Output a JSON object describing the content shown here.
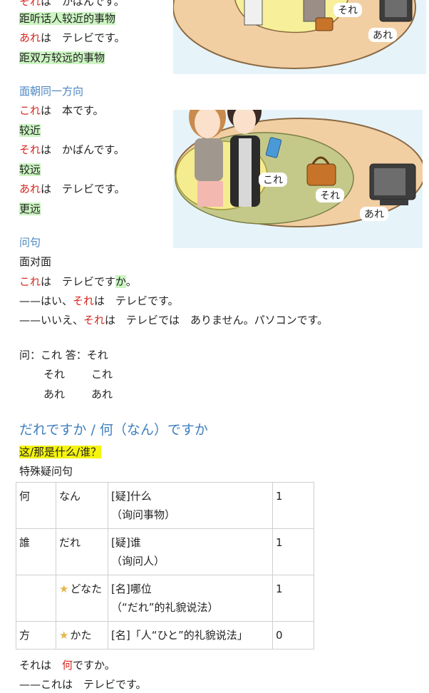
{
  "top": {
    "line1_word": "それ",
    "line1_rest": "は　かばんです。",
    "line2": "距听话人较近的事物",
    "line3_word": "あれ",
    "line3_rest": "は　テレビです。",
    "line4": "距双方较远的事物"
  },
  "section_same": {
    "heading": "面朝同一方向",
    "l1_word": "これ",
    "l1_rest": "は　本です。",
    "l2": "较近",
    "l3_word": "それ",
    "l3_rest": "は　かばんです。",
    "l4": "较远",
    "l5_word": "あれ",
    "l5_rest": "は　テレビです。",
    "l6": "更远"
  },
  "illustration_top": {
    "label_sore": "それ",
    "label_are": "あれ"
  },
  "illustration_mid": {
    "label_kore": "これ",
    "label_sore": "それ",
    "label_are": "あれ"
  },
  "section_question": {
    "heading": "问句",
    "face": "面对面",
    "q_word": "これ",
    "q_rest1": "は　テレビです",
    "q_ka": "か",
    "q_end": "。",
    "a1_dash": "——はい、",
    "a1_word": "それ",
    "a1_rest": "は　テレビです。",
    "a2_dash": "——いいえ、",
    "a2_word": "それ",
    "a2_rest": "は　テレビでは　ありません。パソコンです。"
  },
  "qa_pairs": {
    "row1": "问：これ 答：それ",
    "row2_q": "それ",
    "row2_a": "これ",
    "row3_q": "あれ",
    "row3_a": "あれ"
  },
  "section_who": {
    "title": "だれですか / 何（なん）ですか",
    "subtitle": "这/那是什么/谁？",
    "label": "特殊疑问句"
  },
  "vocab_table": [
    {
      "kanji": "何",
      "kana": "なん",
      "star": false,
      "meaning": "[疑]什么",
      "note": "（询问事物）",
      "accent": "1"
    },
    {
      "kanji": "誰",
      "kana": "だれ",
      "star": false,
      "meaning": "[疑]谁",
      "note": "（询问人）",
      "accent": "1"
    },
    {
      "kanji": "",
      "kana": "どなた",
      "star": true,
      "meaning": "[名]哪位",
      "note": "（“だれ”的礼貌说法）",
      "accent": "1"
    },
    {
      "kanji": "方",
      "kana": "かた",
      "star": true,
      "meaning": "[名]「人“ひと”的礼貌说法」",
      "note": "",
      "accent": "0"
    }
  ],
  "example": {
    "line1_pre": "それは　",
    "line1_word": "何",
    "line1_post": "ですか。",
    "line2": "——これは　テレビです。"
  },
  "colors": {
    "accent_blue": "#4b86c2",
    "red": "#d6271f",
    "green_highlight": "#ccf5c2",
    "yellow_highlight": "#f4f40e"
  }
}
